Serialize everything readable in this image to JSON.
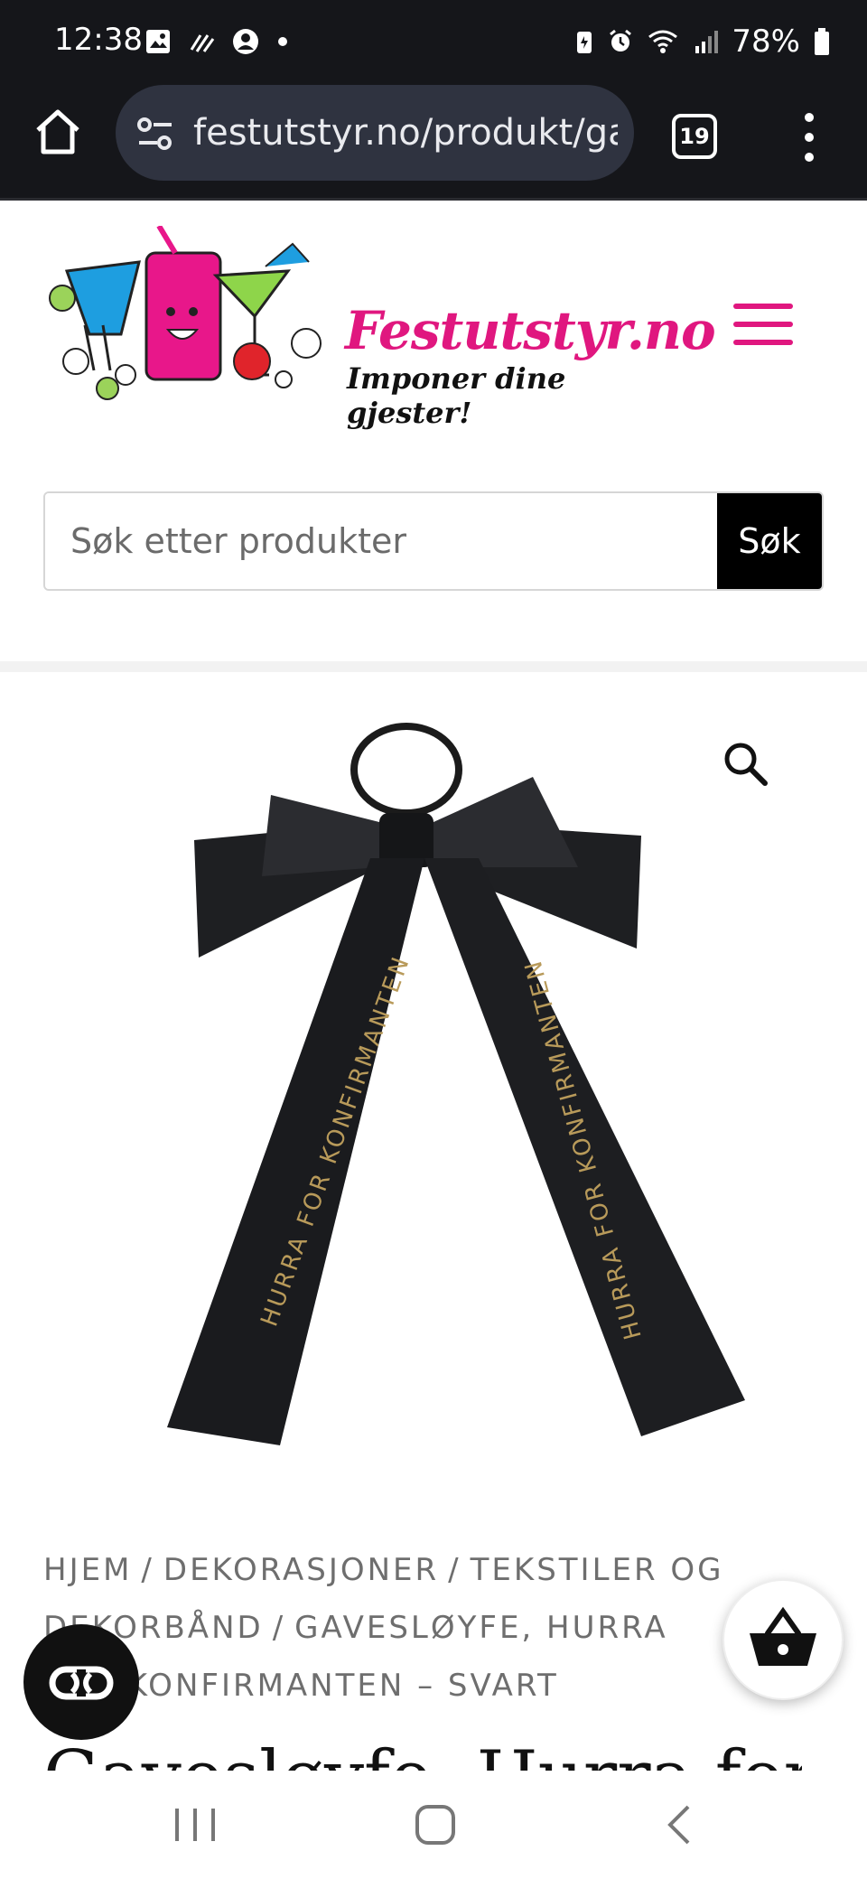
{
  "status_bar": {
    "time": "12:38",
    "battery": "78%"
  },
  "browser": {
    "url": "festutstyr.no/produkt/gavesloyfe",
    "tab_count": "19"
  },
  "site": {
    "brand": "Festutstyr.no",
    "tagline": "Imponer dine gjester!"
  },
  "search": {
    "placeholder": "Søk etter produkter",
    "button": "Søk"
  },
  "product": {
    "ribbon_text": "HURRA FOR KONFIRMANTEN"
  },
  "breadcrumb": {
    "items": [
      "Hjem",
      "Dekorasjoner",
      "Tekstiler og dekorbånd",
      "Gavesløyfe, Hurra for konfirmanten – svart"
    ]
  },
  "title_peek": "Gavesløyfe, Hurra for",
  "colors": {
    "brand_pink": "#e0177f",
    "browser_bg": "#15161a",
    "url_pill": "#2f3340"
  },
  "icons": [
    "home-icon",
    "tune-icon",
    "kebab-icon",
    "hamburger-icon",
    "zoom-icon",
    "cart-icon",
    "accessibility-icon"
  ]
}
